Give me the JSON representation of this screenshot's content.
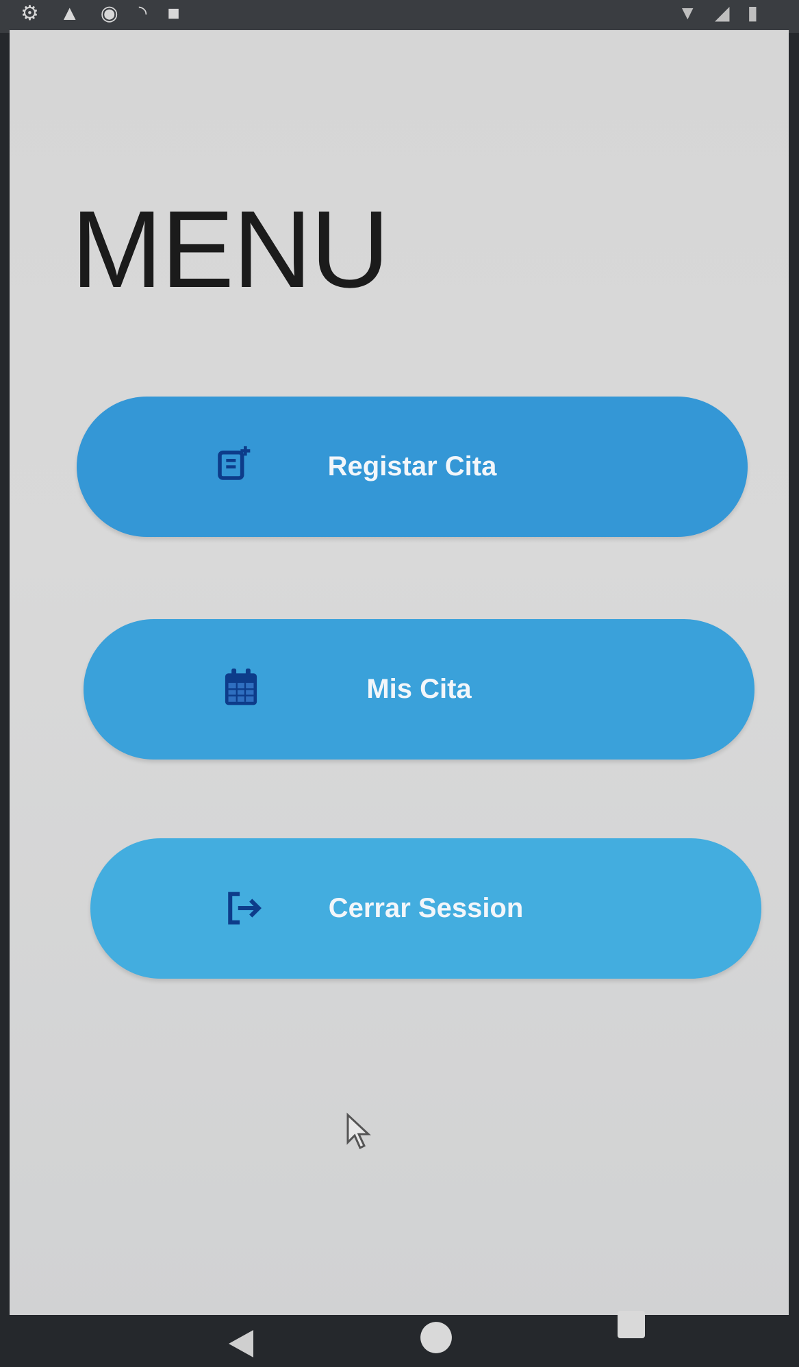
{
  "title": "MENU",
  "buttons": [
    {
      "label": "Registar Cita",
      "icon": "add-note-icon"
    },
    {
      "label": "Mis Cita",
      "icon": "calendar-icon"
    },
    {
      "label": "Cerrar Session",
      "icon": "logout-icon"
    }
  ],
  "colors": {
    "button_primary": "#3497d6",
    "icon": "#0d3c8a",
    "background": "#d8d8d8",
    "title": "#1b1b1b"
  },
  "nav": [
    "back-icon",
    "home-icon",
    "recents-icon"
  ]
}
